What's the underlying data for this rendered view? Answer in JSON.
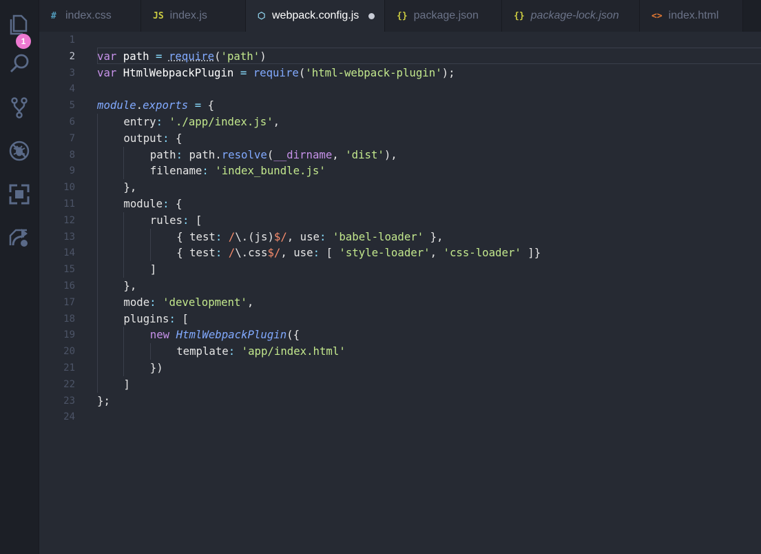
{
  "activity_bar": {
    "items": [
      {
        "icon": "files-icon",
        "badge": "1"
      },
      {
        "icon": "search-icon"
      },
      {
        "icon": "source-control-icon"
      },
      {
        "icon": "debug-icon"
      },
      {
        "icon": "extensions-icon"
      },
      {
        "icon": "live-share-icon"
      }
    ],
    "badge_color": "#ee79d1"
  },
  "tabs": [
    {
      "icon": "#",
      "icon_color": "#519aba",
      "label": "index.css",
      "active": false,
      "italic": false
    },
    {
      "icon": "JS",
      "icon_color": "#cbcb41",
      "label": "index.js",
      "active": false,
      "italic": false
    },
    {
      "icon": "⬡",
      "icon_color": "#8ecfe8",
      "label": "webpack.config.js",
      "active": true,
      "italic": false,
      "dirty": true
    },
    {
      "icon": "{}",
      "icon_color": "#cbcb41",
      "label": "package.json",
      "active": false,
      "italic": false
    },
    {
      "icon": "{}",
      "icon_color": "#cbcb41",
      "label": "package-lock.json",
      "active": false,
      "italic": true
    },
    {
      "icon": "<>",
      "icon_color": "#e37933",
      "label": "index.html",
      "active": false,
      "italic": false
    }
  ],
  "editor": {
    "current_line": 2,
    "line_numbers": [
      "1",
      "2",
      "3",
      "4",
      "5",
      "6",
      "7",
      "8",
      "9",
      "10",
      "11",
      "12",
      "13",
      "14",
      "15",
      "16",
      "17",
      "18",
      "19",
      "20",
      "21",
      "22",
      "23",
      "24"
    ],
    "lines": [
      {
        "indent": 0,
        "tokens": []
      },
      {
        "indent": 0,
        "tokens": [
          [
            "kw",
            "var"
          ],
          [
            "punc",
            " "
          ],
          [
            "var",
            "path"
          ],
          [
            "punc",
            " "
          ],
          [
            "op",
            "="
          ],
          [
            "punc",
            " "
          ],
          [
            "fn-sq",
            "require"
          ],
          [
            "punc",
            "("
          ],
          [
            "str",
            "'path'"
          ],
          [
            "punc",
            ")"
          ]
        ]
      },
      {
        "indent": 0,
        "tokens": [
          [
            "kw",
            "var"
          ],
          [
            "punc",
            " "
          ],
          [
            "var",
            "HtmlWebpackPlugin"
          ],
          [
            "punc",
            " "
          ],
          [
            "op",
            "="
          ],
          [
            "punc",
            " "
          ],
          [
            "fn",
            "require"
          ],
          [
            "punc",
            "("
          ],
          [
            "str",
            "'html-webpack-plugin'"
          ],
          [
            "punc",
            ");"
          ]
        ]
      },
      {
        "indent": 0,
        "tokens": []
      },
      {
        "indent": 0,
        "tokens": [
          [
            "obj",
            "module"
          ],
          [
            "punc",
            "."
          ],
          [
            "obj",
            "exports"
          ],
          [
            "punc",
            " "
          ],
          [
            "op",
            "="
          ],
          [
            "punc",
            " {"
          ]
        ]
      },
      {
        "indent": 1,
        "tokens": [
          [
            "prop",
            "entry"
          ],
          [
            "op",
            ":"
          ],
          [
            "punc",
            " "
          ],
          [
            "str",
            "'./app/index.js'"
          ],
          [
            "punc",
            ","
          ]
        ]
      },
      {
        "indent": 1,
        "tokens": [
          [
            "prop",
            "output"
          ],
          [
            "op",
            ":"
          ],
          [
            "punc",
            " {"
          ]
        ]
      },
      {
        "indent": 2,
        "tokens": [
          [
            "prop",
            "path"
          ],
          [
            "op",
            ":"
          ],
          [
            "punc",
            " path."
          ],
          [
            "fn",
            "resolve"
          ],
          [
            "punc",
            "("
          ],
          [
            "special",
            "__dirname"
          ],
          [
            "punc",
            ", "
          ],
          [
            "str",
            "'dist'"
          ],
          [
            "punc",
            "),"
          ]
        ]
      },
      {
        "indent": 2,
        "tokens": [
          [
            "prop",
            "filename"
          ],
          [
            "op",
            ":"
          ],
          [
            "punc",
            " "
          ],
          [
            "str",
            "'index_bundle.js'"
          ]
        ]
      },
      {
        "indent": 1,
        "tokens": [
          [
            "punc",
            "},"
          ]
        ]
      },
      {
        "indent": 1,
        "tokens": [
          [
            "prop",
            "module"
          ],
          [
            "op",
            ":"
          ],
          [
            "punc",
            " {"
          ]
        ]
      },
      {
        "indent": 2,
        "tokens": [
          [
            "prop",
            "rules"
          ],
          [
            "op",
            ":"
          ],
          [
            "punc",
            " ["
          ]
        ]
      },
      {
        "indent": 3,
        "tokens": [
          [
            "punc",
            "{ "
          ],
          [
            "prop",
            "test"
          ],
          [
            "op",
            ":"
          ],
          [
            "punc",
            " "
          ],
          [
            "regex",
            "/"
          ],
          [
            "punc",
            "\\.(js)"
          ],
          [
            "regex",
            "$/"
          ],
          [
            "punc",
            ", "
          ],
          [
            "prop",
            "use"
          ],
          [
            "op",
            ":"
          ],
          [
            "punc",
            " "
          ],
          [
            "str",
            "'babel-loader'"
          ],
          [
            "punc",
            " },"
          ]
        ]
      },
      {
        "indent": 3,
        "tokens": [
          [
            "punc",
            "{ "
          ],
          [
            "prop",
            "test"
          ],
          [
            "op",
            ":"
          ],
          [
            "punc",
            " "
          ],
          [
            "regex",
            "/"
          ],
          [
            "punc",
            "\\.css"
          ],
          [
            "regex",
            "$/"
          ],
          [
            "punc",
            ", "
          ],
          [
            "prop",
            "use"
          ],
          [
            "op",
            ":"
          ],
          [
            "punc",
            " [ "
          ],
          [
            "str",
            "'style-loader'"
          ],
          [
            "punc",
            ", "
          ],
          [
            "str",
            "'css-loader'"
          ],
          [
            "punc",
            " ]}"
          ]
        ]
      },
      {
        "indent": 2,
        "tokens": [
          [
            "punc",
            "]"
          ]
        ]
      },
      {
        "indent": 1,
        "tokens": [
          [
            "punc",
            "},"
          ]
        ]
      },
      {
        "indent": 1,
        "tokens": [
          [
            "prop",
            "mode"
          ],
          [
            "op",
            ":"
          ],
          [
            "punc",
            " "
          ],
          [
            "str",
            "'development'"
          ],
          [
            "punc",
            ","
          ]
        ]
      },
      {
        "indent": 1,
        "tokens": [
          [
            "prop",
            "plugins"
          ],
          [
            "op",
            ":"
          ],
          [
            "punc",
            " ["
          ]
        ]
      },
      {
        "indent": 2,
        "tokens": [
          [
            "kw",
            "new"
          ],
          [
            "punc",
            " "
          ],
          [
            "cls",
            "HtmlWebpackPlugin"
          ],
          [
            "punc",
            "({"
          ]
        ]
      },
      {
        "indent": 3,
        "tokens": [
          [
            "prop",
            "template"
          ],
          [
            "op",
            ":"
          ],
          [
            "punc",
            " "
          ],
          [
            "str",
            "'app/index.html'"
          ]
        ]
      },
      {
        "indent": 2,
        "tokens": [
          [
            "punc",
            "})"
          ]
        ]
      },
      {
        "indent": 1,
        "tokens": [
          [
            "punc",
            "]"
          ]
        ]
      },
      {
        "indent": 0,
        "tokens": [
          [
            "punc",
            "};"
          ]
        ]
      },
      {
        "indent": 0,
        "tokens": []
      }
    ]
  }
}
